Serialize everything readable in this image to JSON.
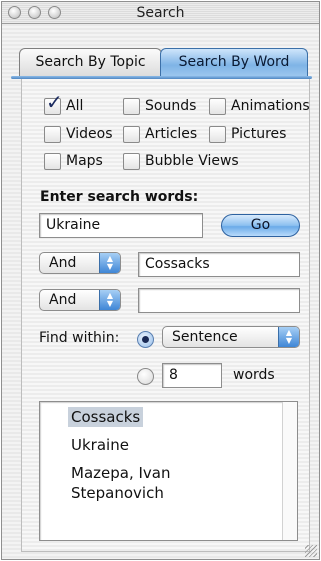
{
  "window": {
    "title": "Search"
  },
  "tabs": [
    {
      "label": "Search By Topic",
      "active": false
    },
    {
      "label": "Search By Word",
      "active": true
    }
  ],
  "filters": [
    {
      "label": "All",
      "checked": true
    },
    {
      "label": "Sounds",
      "checked": false
    },
    {
      "label": "Animations",
      "checked": false
    },
    {
      "label": "Videos",
      "checked": false
    },
    {
      "label": "Articles",
      "checked": false
    },
    {
      "label": "Pictures",
      "checked": false
    },
    {
      "label": "Maps",
      "checked": false
    },
    {
      "label": "Bubble Views",
      "checked": false
    }
  ],
  "search": {
    "label": "Enter search words:",
    "word1": "Ukraine",
    "go_label": "Go",
    "operator2": "And",
    "word2": "Cossacks",
    "operator3": "And",
    "word3": ""
  },
  "find_within": {
    "label": "Find within:",
    "option_selected": "Sentence",
    "count": "8",
    "count_unit": "words"
  },
  "results": [
    "Cossacks",
    "Ukraine",
    "Mazepa, Ivan Stepanovich"
  ],
  "colors": {
    "active_tab": "#7fb4e6",
    "go_button": "#8cc0f0",
    "popup_arrows": "#3f86d6",
    "selection": "#c8d1dc"
  }
}
